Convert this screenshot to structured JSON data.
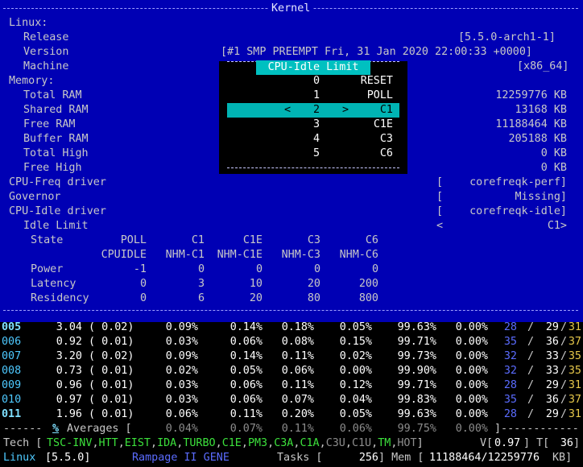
{
  "kernel": {
    "title": "Kernel",
    "linux_label": "Linux:",
    "release_label": "Release",
    "release_value": "[5.5.0-arch1-1]",
    "version_label": "Version",
    "version_value": "[#1 SMP PREEMPT Fri, 31 Jan 2020 22:00:33 +0000]",
    "machine_label": "Machine",
    "machine_value": "[x86_64]",
    "memory_label": "Memory:",
    "total_ram_label": "Total RAM",
    "total_ram_value": "12259776 KB",
    "shared_ram_label": "Shared RAM",
    "shared_ram_value": "13168 KB",
    "free_ram_label": "Free RAM",
    "free_ram_value": "11188464 KB",
    "buffer_ram_label": "Buffer RAM",
    "buffer_ram_value": "205188 KB",
    "total_high_label": "Total High",
    "total_high_value": "0 KB",
    "free_high_label": "Free High",
    "free_high_value": "0 KB",
    "cpufreq_label": "CPU-Freq driver",
    "cpufreq_value": "corefreqk-perf]",
    "governor_label": "Governor",
    "governor_value": "Missing]",
    "cpuidle_label": "CPU-Idle driver",
    "cpuidle_value": "corefreqk-idle]",
    "bracket_open": "[",
    "idle_limit_label": "Idle Limit",
    "idle_limit_open": "<",
    "idle_limit_value": "C1>",
    "state_label": "State",
    "state_cols": [
      "POLL",
      "C1",
      "C1E",
      "C3",
      "C6"
    ],
    "state_names": [
      "CPUIDLE",
      "NHM-C1",
      "NHM-C1E",
      "NHM-C3",
      "NHM-C6"
    ],
    "power_label": "Power",
    "power_values": [
      "-1",
      "0",
      "0",
      "0",
      "0"
    ],
    "latency_label": "Latency",
    "latency_values": [
      "0",
      "3",
      "10",
      "20",
      "200"
    ],
    "residency_label": "Residency",
    "residency_values": [
      "0",
      "6",
      "20",
      "80",
      "800"
    ]
  },
  "popup": {
    "title": "CPU-Idle Limit",
    "items": [
      {
        "index": "0",
        "name": "RESET"
      },
      {
        "index": "1",
        "name": "POLL"
      },
      {
        "index": "2",
        "name": "C1"
      },
      {
        "index": "3",
        "name": "C1E"
      },
      {
        "index": "4",
        "name": "C3"
      },
      {
        "index": "5",
        "name": "C6"
      }
    ],
    "selected_left_arrow": "<",
    "selected_right_arrow": ">"
  },
  "cores": [
    {
      "id": "005",
      "freq": "3.04",
      "ratio": "( 0.02)",
      "c0": "0.09%",
      "c1": "0.14%",
      "c3": "0.18%",
      "c6": "0.05%",
      "c7": "99.63%",
      "c8": "0.00%",
      "t1": "28",
      "t2": "29",
      "t3": "31"
    },
    {
      "id": "006",
      "freq": "0.92",
      "ratio": "( 0.01)",
      "c0": "0.03%",
      "c1": "0.06%",
      "c3": "0.08%",
      "c6": "0.15%",
      "c7": "99.71%",
      "c8": "0.00%",
      "t1": "35",
      "t2": "36",
      "t3": "37"
    },
    {
      "id": "007",
      "freq": "3.20",
      "ratio": "( 0.02)",
      "c0": "0.09%",
      "c1": "0.14%",
      "c3": "0.11%",
      "c6": "0.02%",
      "c7": "99.73%",
      "c8": "0.00%",
      "t1": "32",
      "t2": "33",
      "t3": "35"
    },
    {
      "id": "008",
      "freq": "0.73",
      "ratio": "( 0.01)",
      "c0": "0.02%",
      "c1": "0.05%",
      "c3": "0.06%",
      "c6": "0.00%",
      "c7": "99.90%",
      "c8": "0.00%",
      "t1": "32",
      "t2": "33",
      "t3": "35"
    },
    {
      "id": "009",
      "freq": "0.96",
      "ratio": "( 0.01)",
      "c0": "0.03%",
      "c1": "0.06%",
      "c3": "0.11%",
      "c6": "0.12%",
      "c7": "99.71%",
      "c8": "0.00%",
      "t1": "28",
      "t2": "29",
      "t3": "31"
    },
    {
      "id": "010",
      "freq": "0.97",
      "ratio": "( 0.01)",
      "c0": "0.03%",
      "c1": "0.06%",
      "c3": "0.07%",
      "c6": "0.04%",
      "c7": "99.83%",
      "c8": "0.00%",
      "t1": "35",
      "t2": "36",
      "t3": "37"
    },
    {
      "id": "011",
      "freq": "1.96",
      "ratio": "( 0.01)",
      "c0": "0.06%",
      "c1": "0.11%",
      "c3": "0.20%",
      "c6": "0.05%",
      "c7": "99.63%",
      "c8": "0.00%",
      "t1": "28",
      "t2": "29",
      "t3": "31"
    }
  ],
  "averages": {
    "lead": "------",
    "hotkey": "%",
    "label": "Averages [",
    "values": [
      "0.04%",
      "0.07%",
      "0.11%",
      "0.06%",
      "99.75%",
      "0.00%"
    ],
    "tail": "]------------"
  },
  "tech": {
    "label": "Tech [",
    "items": [
      {
        "name": "TSC-INV",
        "on": true
      },
      {
        "name": "HTT",
        "on": true
      },
      {
        "name": "EIST",
        "on": true
      },
      {
        "name": "IDA",
        "on": true
      },
      {
        "name": "TURBO",
        "on": true
      },
      {
        "name": "C1E",
        "on": true
      },
      {
        "name": "PM3",
        "on": true
      },
      {
        "name": "C3A",
        "on": true
      },
      {
        "name": "C1A",
        "on": true
      },
      {
        "name": "C3U",
        "on": false
      },
      {
        "name": "C1U",
        "on": false
      },
      {
        "name": "TM",
        "on": true
      },
      {
        "name": "HOT",
        "on": false
      }
    ],
    "close": "]",
    "v_label": "V[",
    "v_value": "0.97",
    "t_label": "] T[",
    "t_value": "36",
    "t_close": "]"
  },
  "status": {
    "os_label": "Linux",
    "os_value": "[5.5.0]",
    "board": "Rampage II GENE",
    "tasks_label": "Tasks [",
    "tasks_value": "256",
    "mem_label": "] Mem [",
    "mem_value": "11188464/12259776",
    "mem_unit": "KB]"
  },
  "colors": {
    "window_bg": "#0000b4",
    "popup_title_bg": "#00c0c0",
    "selected_bg": "#00b4b4",
    "tech_on": "#3ce03c",
    "tech_off": "#8c8c8c"
  }
}
